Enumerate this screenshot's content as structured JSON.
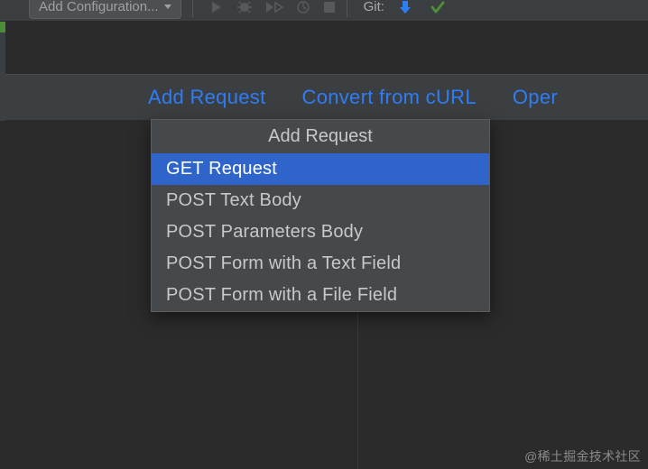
{
  "toolbar": {
    "config_label": "Add Configuration...",
    "git_label": "Git:"
  },
  "linkbar": {
    "add_request": "Add Request",
    "convert_curl": "Convert from cURL",
    "open": "Oper"
  },
  "popup": {
    "title": "Add Request",
    "items": [
      {
        "label": "GET Request",
        "selected": true
      },
      {
        "label": "POST Text Body",
        "selected": false
      },
      {
        "label": "POST Parameters Body",
        "selected": false
      },
      {
        "label": "POST Form with a Text Field",
        "selected": false
      },
      {
        "label": "POST Form with a File Field",
        "selected": false
      }
    ]
  },
  "watermark": "@稀土掘金技术社区"
}
